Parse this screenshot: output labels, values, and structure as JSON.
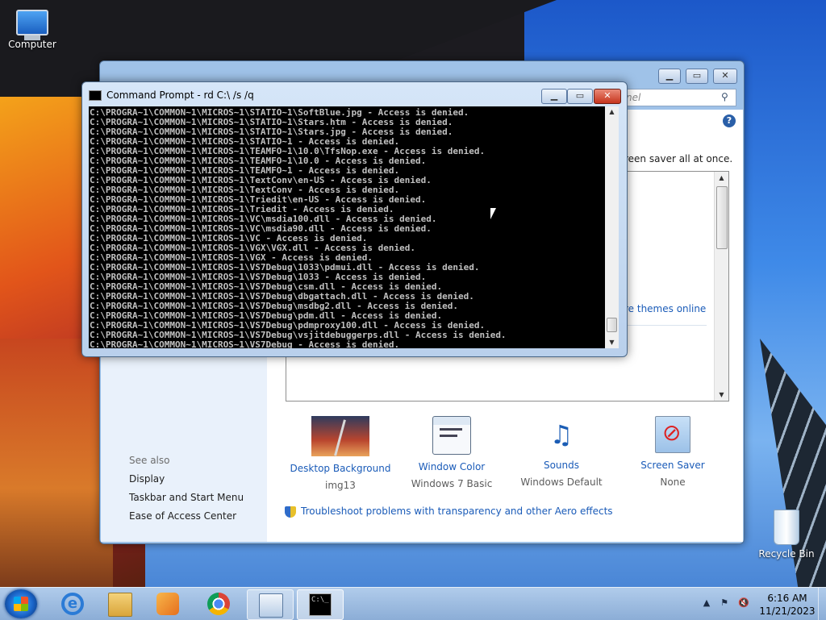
{
  "desktop": {
    "icons": [
      {
        "label": "Computer"
      },
      {
        "label": "Recycle Bin"
      }
    ]
  },
  "personalization": {
    "search_placeholder": "nel",
    "description": "reen saver all at once.",
    "themes_link": "re themes online",
    "settings": [
      {
        "label": "Desktop Background",
        "value": "img13",
        "icon": "desktop-background-icon"
      },
      {
        "label": "Window Color",
        "value": "Windows 7 Basic",
        "icon": "window-color-icon"
      },
      {
        "label": "Sounds",
        "value": "Windows Default",
        "icon": "sounds-icon"
      },
      {
        "label": "Screen Saver",
        "value": "None",
        "icon": "screen-saver-icon"
      }
    ],
    "see_also": {
      "heading": "See also",
      "links": [
        "Display",
        "Taskbar and Start Menu",
        "Ease of Access Center"
      ]
    },
    "troubleshoot": "Troubleshoot problems with transparency and other Aero effects"
  },
  "cmd": {
    "title": "Command Prompt - rd  C:\\ /s /q",
    "lines": [
      "C:\\PROGRA~1\\COMMON~1\\MICROS~1\\STATIO~1\\SoftBlue.jpg - Access is denied.",
      "C:\\PROGRA~1\\COMMON~1\\MICROS~1\\STATIO~1\\Stars.htm - Access is denied.",
      "C:\\PROGRA~1\\COMMON~1\\MICROS~1\\STATIO~1\\Stars.jpg - Access is denied.",
      "C:\\PROGRA~1\\COMMON~1\\MICROS~1\\STATIO~1 - Access is denied.",
      "C:\\PROGRA~1\\COMMON~1\\MICROS~1\\TEAMFO~1\\10.0\\TfsNop.exe - Access is denied.",
      "C:\\PROGRA~1\\COMMON~1\\MICROS~1\\TEAMFO~1\\10.0 - Access is denied.",
      "C:\\PROGRA~1\\COMMON~1\\MICROS~1\\TEAMFO~1 - Access is denied.",
      "C:\\PROGRA~1\\COMMON~1\\MICROS~1\\TextConv\\en-US - Access is denied.",
      "C:\\PROGRA~1\\COMMON~1\\MICROS~1\\TextConv - Access is denied.",
      "C:\\PROGRA~1\\COMMON~1\\MICROS~1\\Triedit\\en-US - Access is denied.",
      "C:\\PROGRA~1\\COMMON~1\\MICROS~1\\Triedit - Access is denied.",
      "C:\\PROGRA~1\\COMMON~1\\MICROS~1\\VC\\msdia100.dll - Access is denied.",
      "C:\\PROGRA~1\\COMMON~1\\MICROS~1\\VC\\msdia90.dll - Access is denied.",
      "C:\\PROGRA~1\\COMMON~1\\MICROS~1\\VC - Access is denied.",
      "C:\\PROGRA~1\\COMMON~1\\MICROS~1\\VGX\\VGX.dll - Access is denied.",
      "C:\\PROGRA~1\\COMMON~1\\MICROS~1\\VGX - Access is denied.",
      "C:\\PROGRA~1\\COMMON~1\\MICROS~1\\VS7Debug\\1033\\pdmui.dll - Access is denied.",
      "C:\\PROGRA~1\\COMMON~1\\MICROS~1\\VS7Debug\\1033 - Access is denied.",
      "C:\\PROGRA~1\\COMMON~1\\MICROS~1\\VS7Debug\\csm.dll - Access is denied.",
      "C:\\PROGRA~1\\COMMON~1\\MICROS~1\\VS7Debug\\dbgattach.dll - Access is denied.",
      "C:\\PROGRA~1\\COMMON~1\\MICROS~1\\VS7Debug\\msdbg2.dll - Access is denied.",
      "C:\\PROGRA~1\\COMMON~1\\MICROS~1\\VS7Debug\\pdm.dll - Access is denied.",
      "C:\\PROGRA~1\\COMMON~1\\MICROS~1\\VS7Debug\\pdmproxy100.dll - Access is denied.",
      "C:\\PROGRA~1\\COMMON~1\\MICROS~1\\VS7Debug\\vsjitdebuggerps.dll - Access is denied.",
      "C:\\PROGRA~1\\COMMON~1\\MICROS~1\\VS7Debug - Access is denied."
    ]
  },
  "taskbar": {
    "pinned": [
      "internet-explorer-icon",
      "windows-explorer-icon",
      "media-player-icon",
      "chrome-icon",
      "control-panel-icon",
      "command-prompt-icon"
    ],
    "cmd_glyph": "C:\\_",
    "clock": {
      "time": "6:16 AM",
      "date": "11/21/2023"
    }
  }
}
